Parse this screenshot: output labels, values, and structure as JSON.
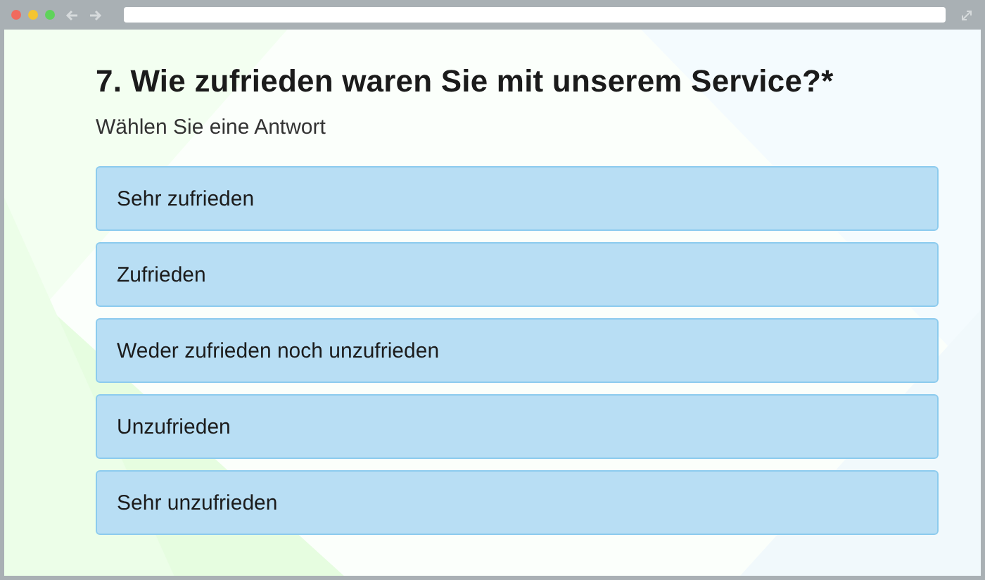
{
  "question": {
    "title": "7. Wie zufrieden waren Sie mit unserem Service?*",
    "hint": "Wählen Sie eine Antwort"
  },
  "options": [
    {
      "label": "Sehr zufrieden",
      "selected": false
    },
    {
      "label": "Zufrieden",
      "selected": false
    },
    {
      "label": "Weder zufrieden noch unzufrieden",
      "selected": false
    },
    {
      "label": "Unzufrieden",
      "selected": false
    },
    {
      "label": "Sehr unzufrieden",
      "selected": false
    }
  ]
}
